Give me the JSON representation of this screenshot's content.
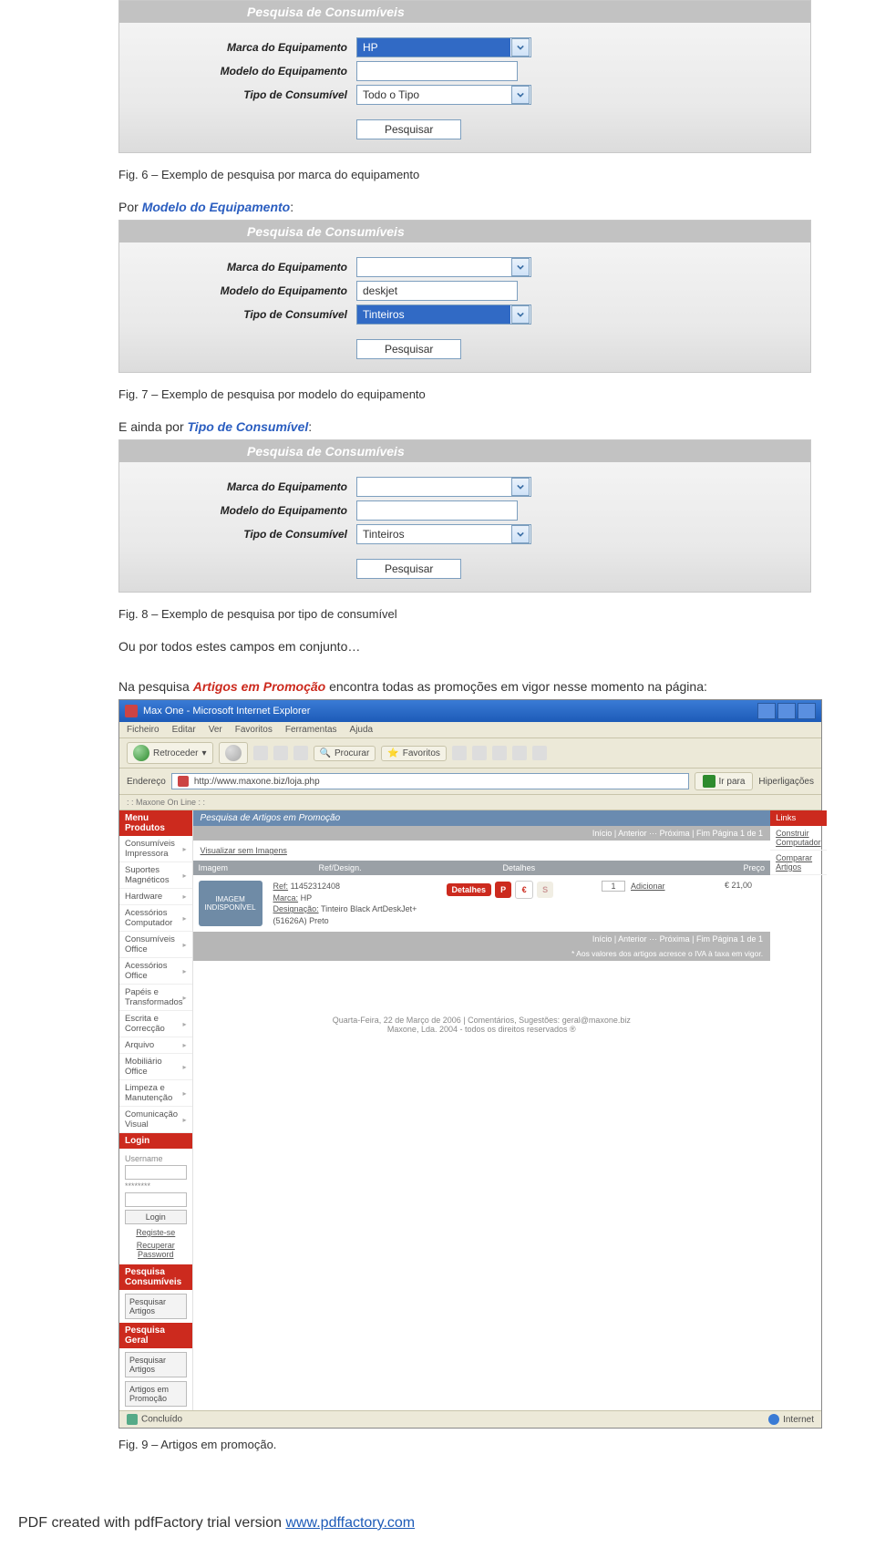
{
  "panels": {
    "header": "Pesquisa de Consumíveis",
    "labels": {
      "marca": "Marca do Equipamento",
      "modelo": "Modelo do Equipamento",
      "tipo": "Tipo de Consumível"
    },
    "button": "Pesquisar"
  },
  "fig6": {
    "marca_value": "HP",
    "modelo_value": "",
    "tipo_value": "Todo o Tipo",
    "caption": "Fig. 6 – Exemplo de pesquisa por marca do equipamento"
  },
  "lead_modelo_prefix": "Por ",
  "lead_modelo_hl": "Modelo do Equipamento",
  "fig7": {
    "marca_value": "",
    "modelo_value": "deskjet",
    "tipo_value": "Tinteiros",
    "caption": "Fig. 7 – Exemplo de pesquisa por modelo do equipamento"
  },
  "lead_tipo_prefix": "E ainda por ",
  "lead_tipo_hl": "Tipo de Consumível",
  "fig8": {
    "marca_value": "",
    "modelo_value": "",
    "tipo_value": "Tinteiros",
    "caption": "Fig. 8 – Exemplo de pesquisa por tipo de consumível"
  },
  "post_fig8_line1": "Ou por todos estes campos em conjunto…",
  "post_fig8_line2_a": "Na pesquisa ",
  "post_fig8_line2_hl": "Artigos em Promoção",
  "post_fig8_line2_b": " encontra todas as promoções em vigor nesse momento na página:",
  "browser": {
    "title": "Max One - Microsoft Internet Explorer",
    "menu": [
      "Ficheiro",
      "Editar",
      "Ver",
      "Favoritos",
      "Ferramentas",
      "Ajuda"
    ],
    "back": "Retroceder",
    "search_btn": "Procurar",
    "fav_btn": "Favoritos",
    "addr_label": "Endereço",
    "addr_value": "http://www.maxone.biz/loja.php",
    "go": "Ir para",
    "links": "Hiperligações",
    "brand": ": : Maxone On Line : :",
    "menu_produtos": "Menu Produtos",
    "side_items": [
      "Consumíveis Impressora",
      "Suportes Magnéticos",
      "Hardware",
      "Acessórios Computador",
      "Consumíveis Office",
      "Acessórios Office",
      "Papéis e Transformados",
      "Escrita e Correcção",
      "Arquivo",
      "Mobiliário Office",
      "Limpeza e Manutenção",
      "Comunicação Visual"
    ],
    "login_hdr": "Login",
    "login_user_lbl": "Username",
    "login_pass": "********",
    "login_btn": "Login",
    "login_reg": "Registe-se",
    "login_rec": "Recuperar Password",
    "pesq_cons_hdr": "Pesquisa Consumíveis",
    "pesq_cons_btn": "Pesquisar Artigos",
    "pesq_geral_hdr": "Pesquisa Geral",
    "pesq_geral_btn1": "Pesquisar Artigos",
    "pesq_geral_btn2": "Artigos em Promoção",
    "right_hdr": "Links",
    "right_l1": "Construir Computador",
    "right_l2": "Comparar Artigos",
    "blue_title": "Pesquisa de Artigos em Promoção",
    "nav_top": "Início | Anterior ··· Próxima | Fim  Página 1 de 1",
    "view_link": "Visualizar sem Imagens",
    "th_img": "Imagem",
    "th_ref": "Ref/Design.",
    "th_det": "Detalhes",
    "th_pr": "Preço",
    "thumb": "IMAGEM INDISPONÍVEL",
    "row_ref": "Ref:",
    "row_ref_v": "11452312408",
    "row_marca": "Marca:",
    "row_marca_v": "HP",
    "row_des": "Designação:",
    "row_des_v": "Tinteiro Black ArtDeskJet+ (51626A) Preto",
    "row_det": "Detalhes",
    "row_p": "P",
    "row_qty": "1",
    "row_add": "Adicionar",
    "row_price": "€ 21,00",
    "nav_bot": "Início | Anterior ··· Próxima | Fim  Página 1 de 1",
    "note": "* Aos valores dos artigos acresce o IVA à taxa em vigor.",
    "foot1": "Quarta-Feira, 22 de Março de 2006 | Comentários, Sugestões: geral@maxone.biz",
    "foot2": "Maxone, Lda. 2004 - todos os direitos reservados ®",
    "status_done": "Concluído",
    "status_net": "Internet"
  },
  "fig9_caption": "Fig. 9 – Artigos em promoção.",
  "pdf_footer_text": "PDF created with pdfFactory trial version ",
  "pdf_footer_link": "www.pdffactory.com"
}
